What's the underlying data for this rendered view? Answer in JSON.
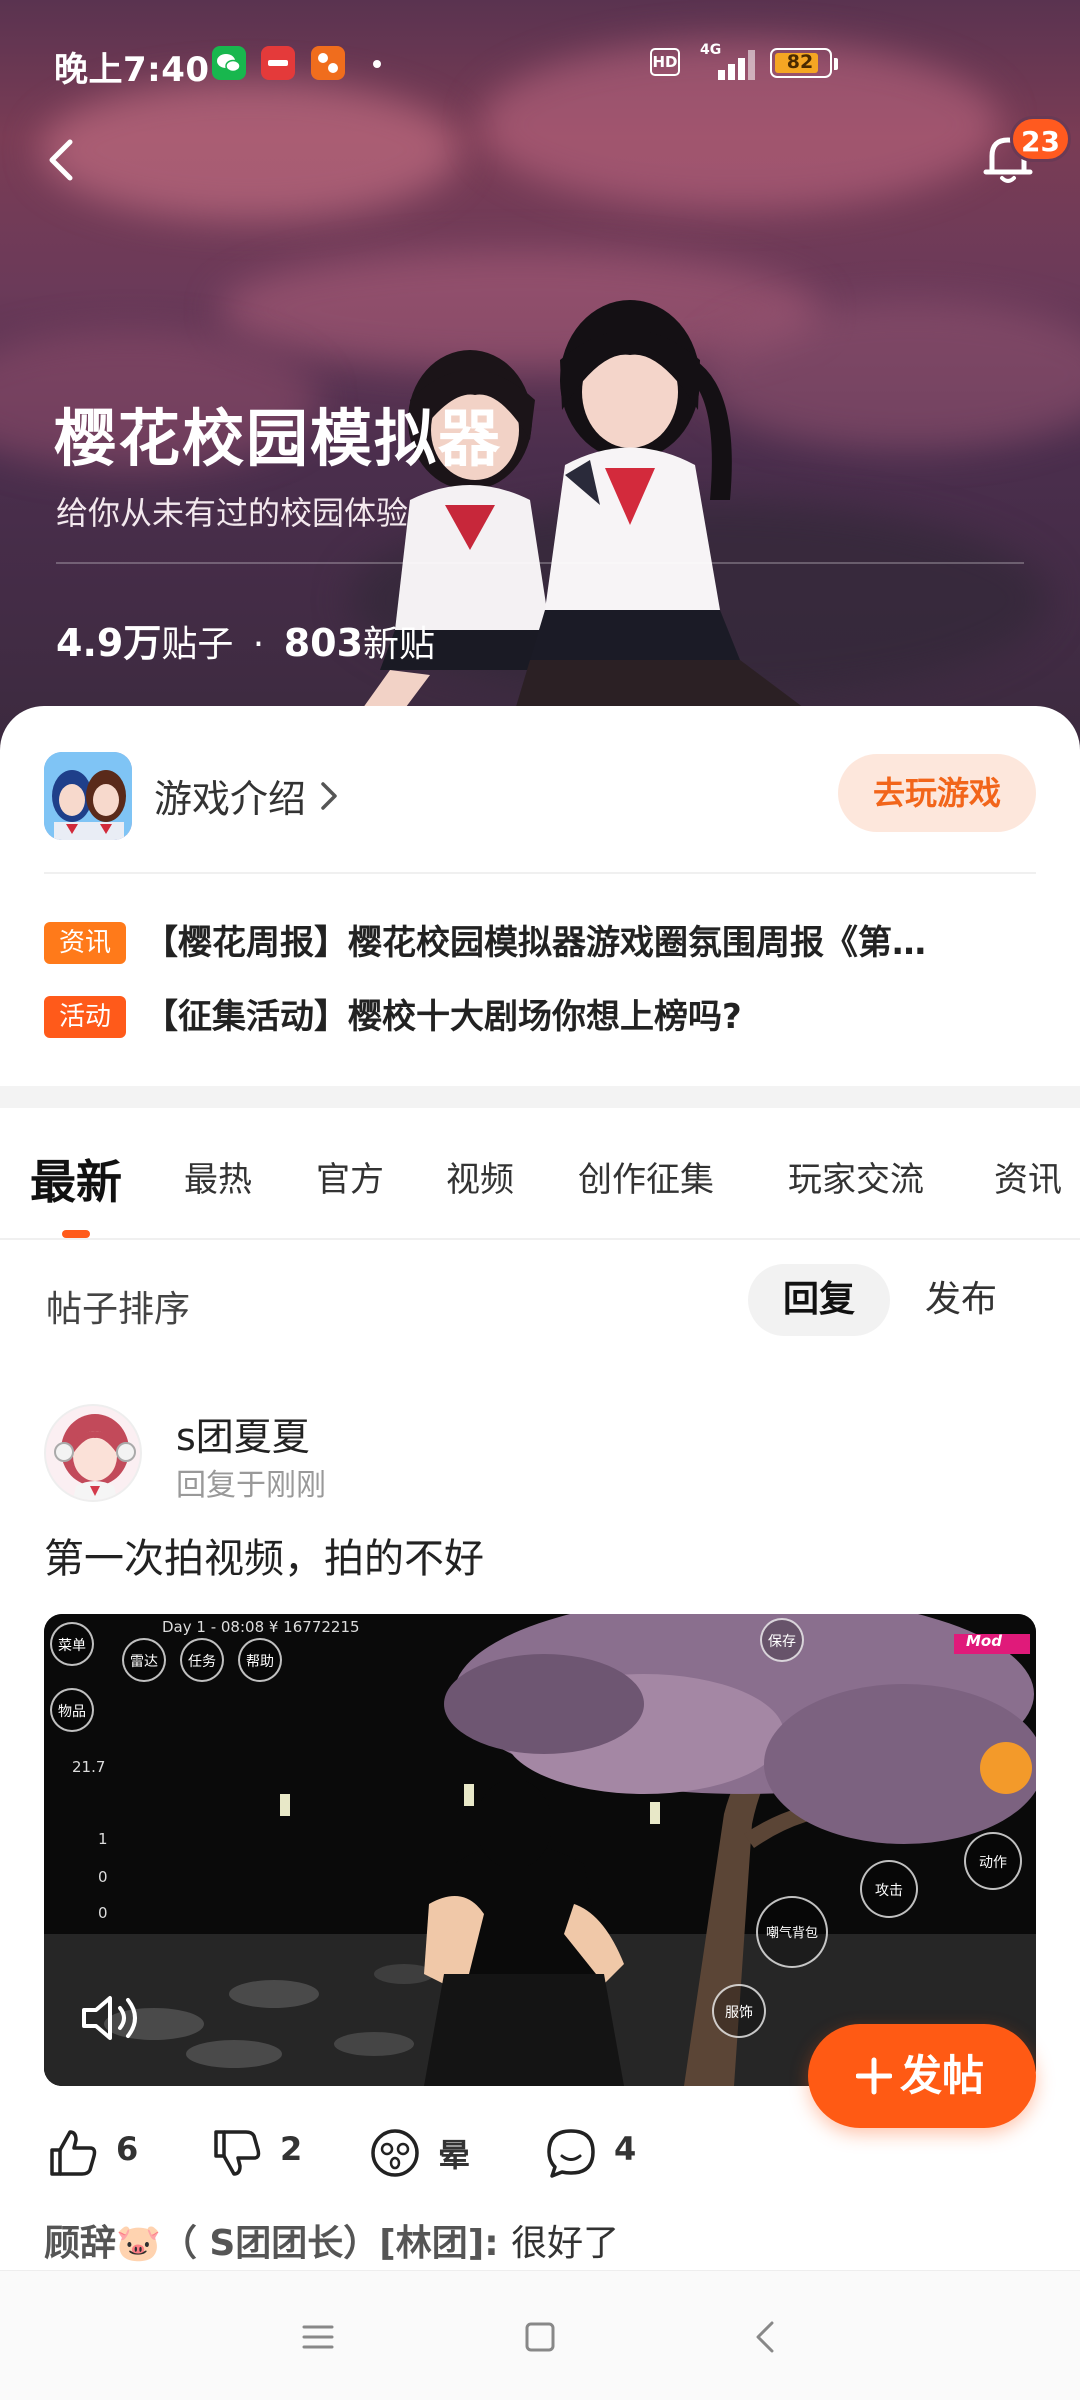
{
  "status_bar": {
    "time": "晚上7:40",
    "app_icons": [
      "wechat-icon",
      "red-app-icon",
      "orange-app-icon"
    ],
    "network": "4G",
    "hd_label": "HD",
    "battery": "82"
  },
  "header": {
    "notification_count": "23",
    "title": "樱花校园模拟器",
    "subtitle": "给你从未有过的校园体验",
    "stats": {
      "posts_value": "4.9万",
      "posts_label": "贴子",
      "separator": "·",
      "new_value": "803",
      "new_label": "新贴"
    }
  },
  "game_card": {
    "intro_label": "游戏介绍",
    "play_button": "去玩游戏",
    "news": [
      {
        "tag": "资讯",
        "title": "【樱花周报】樱花校园模拟器游戏圈氛围周报《第…"
      },
      {
        "tag": "活动",
        "title": "【征集活动】樱校十大剧场你想上榜吗?"
      }
    ]
  },
  "tabs": [
    "最新",
    "最热",
    "官方",
    "视频",
    "创作征集",
    "玩家交流",
    "资讯"
  ],
  "sort": {
    "label": "帖子排序",
    "options": [
      "回复",
      "发布"
    ],
    "selected": "回复"
  },
  "post": {
    "author": "s团夏夏",
    "time": "回复于刚刚",
    "text": "第一次拍视频，拍的不好",
    "video_hud": {
      "day": "Day 1 - 08:08  ¥ 16772215",
      "menu": "菜单",
      "radar": "雷达",
      "task": "任务",
      "help": "帮助",
      "save": "保存",
      "mod": "Mod",
      "items": "物品",
      "stat": "21.7",
      "like_count": "1",
      "friend_count": "0",
      "angry_count": "0",
      "attack": "攻击",
      "action": "动作",
      "anger": "嘲气背包",
      "tag": "服饰"
    },
    "actions": {
      "like": "6",
      "dislike": "2",
      "dizzy": "晕",
      "comment": "4"
    },
    "comment_preview": {
      "name": "顾辞🐷（ S团团长）[林团]: ",
      "text": "很好了"
    }
  },
  "fab": {
    "label": "发帖"
  },
  "colors": {
    "accent": "#ff5a14",
    "play_button_bg": "#fde7dc",
    "tag_orange": "#ff7a1a"
  }
}
